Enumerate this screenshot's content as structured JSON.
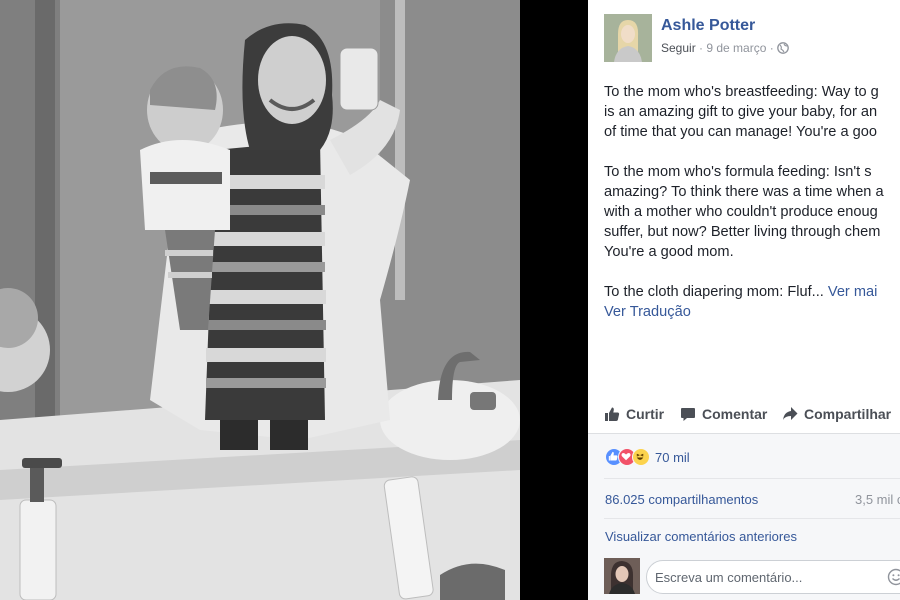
{
  "post": {
    "author_name": "Ashle Potter",
    "follow_label": "Seguir",
    "separator": " · ",
    "date": "9 de março",
    "separator2": " · ",
    "privacy_icon": "globe-icon",
    "paragraphs": [
      {
        "lines": [
          "To the mom who's breastfeeding: Way to g",
          "is an amazing gift to give your baby, for an",
          "of time that you can manage! You're a goo"
        ]
      },
      {
        "lines": [
          "To the mom who's formula feeding: Isn't s",
          "amazing? To think there was a time when a",
          "with a mother who couldn't produce enoug",
          "suffer, but now? Better living through chem",
          "You're a good mom."
        ]
      }
    ],
    "truncated_line": "To the cloth diapering mom: Fluf...",
    "see_more_label": "Ver mai",
    "translate_label": "Ver Tradução"
  },
  "actions": {
    "like_label": "Curtir",
    "comment_label": "Comentar",
    "share_label": "Compartilhar",
    "icons": [
      "thumbs-up-icon",
      "speech-bubble-icon",
      "share-arrow-icon"
    ]
  },
  "feedback": {
    "reaction_icons": [
      "like-reaction-icon",
      "love-reaction-icon",
      "haha-reaction-icon"
    ],
    "reaction_count": "70 mil",
    "shares_label": "86.025 compartilhamentos",
    "views_label": "3,5 mil c",
    "previous_comments_label": "Visualizar comentários anteriores",
    "comment_placeholder": "Escreva um comentário...",
    "emoji_icon": "smiley-icon"
  },
  "colors": {
    "link_blue": "#365899",
    "text": "#1d2129",
    "muted": "#90949c",
    "panel_bg": "#ffffff",
    "feedback_bg": "#f6f7f9",
    "photo_bg": "#000000",
    "like_blue": "#5890ff",
    "love_red": "#f25268",
    "haha_yellow": "#fcd34d"
  }
}
